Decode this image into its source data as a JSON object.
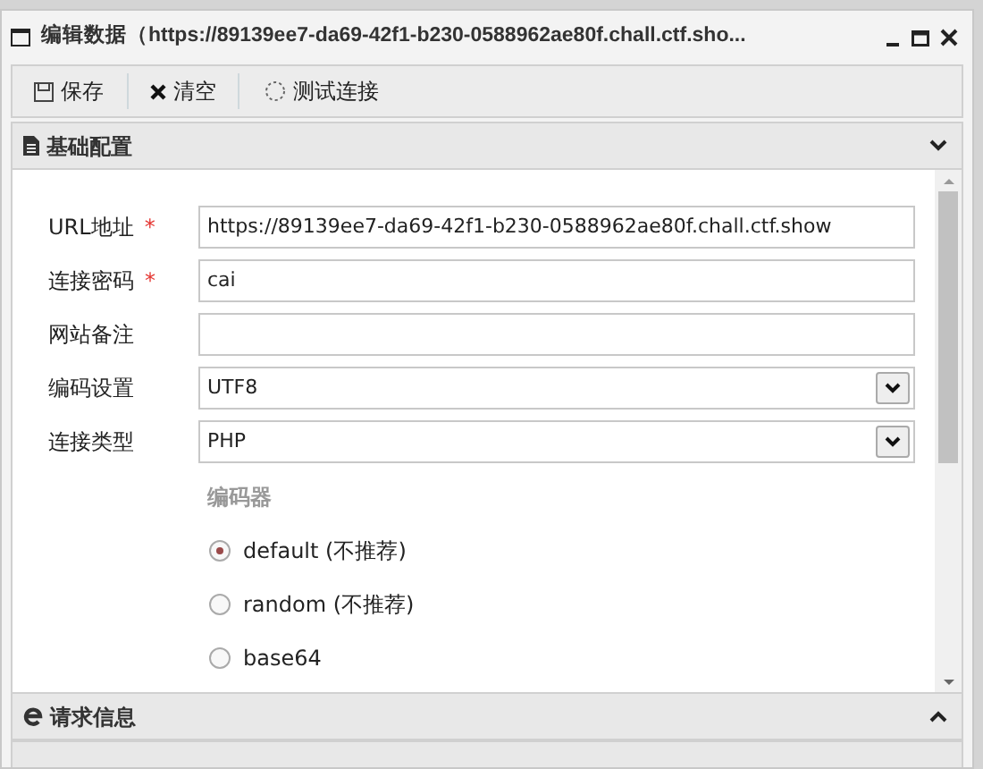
{
  "window": {
    "title": "编辑数据（https://89139ee7-da69-42f1-b230-0588962ae80f.chall.ctf.sho..."
  },
  "toolbar": [
    {
      "kind": "save",
      "label": "保存"
    },
    {
      "kind": "clear",
      "label": "清空"
    },
    {
      "kind": "test",
      "label": "测试连接"
    }
  ],
  "panels": [
    {
      "title": "基础配置",
      "kind": "doc",
      "expanded": true
    },
    {
      "title": "请求信息",
      "kind": "ie",
      "expanded": false
    }
  ],
  "form": {
    "fields": [
      {
        "label": "URL地址",
        "mark": "*",
        "kind": "input",
        "value": "https://89139ee7-da69-42f1-b230-0588962ae80f.chall.ctf.show"
      },
      {
        "label": "连接密码",
        "mark": "*",
        "kind": "input",
        "value": "cai"
      },
      {
        "label": "网站备注",
        "kind": "input"
      },
      {
        "label": "编码设置",
        "kind": "select",
        "value": "UTF8"
      },
      {
        "label": "连接类型",
        "kind": "select",
        "value": "PHP"
      }
    ],
    "encoder_title": "编码器",
    "encoders": [
      {
        "label": "default (不推荐)",
        "selected": true
      },
      {
        "label": "random (不推荐)",
        "selected": false
      },
      {
        "label": "base64",
        "selected": false
      }
    ]
  }
}
